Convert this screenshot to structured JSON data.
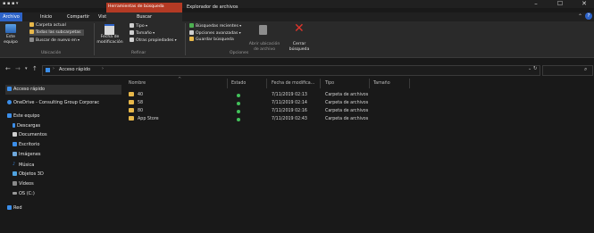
{
  "titlebar": {
    "quick_access": "▪ ▪ ▪ ▾",
    "minimize": "–",
    "maximize": "☐",
    "close": "✕"
  },
  "context_tabs": {
    "search_tools": "Herramientas de búsqueda",
    "window_title": "Explorador de archivos"
  },
  "tabs": [
    "Archivo",
    "Inicio",
    "Compartir",
    "Vista",
    "Buscar"
  ],
  "ribbon": {
    "ubicacion": {
      "este_equipo": "Este\nequipo",
      "carpeta_actual": "Carpeta actual",
      "todas_subcarpetas": "Todas las subcarpetas",
      "buscar_de_nuevo": "Buscar de nuevo en",
      "label": "Ubicación"
    },
    "refinar": {
      "fecha": "Fecha de\nmodificación",
      "tipo": "Tipo",
      "tamano": "Tamaño",
      "otras": "Otras propiedades",
      "label": "Refinar"
    },
    "opciones": {
      "recientes": "Búsquedas recientes",
      "avanzadas": "Opciones avanzadas",
      "guardar": "Guardar búsqueda",
      "abrir": "Abrir ubicación\nde archivo",
      "cerrar": "Cerrar\nbúsqueda",
      "label": "Opciones"
    }
  },
  "address": {
    "path": "Acceso rápido",
    "separator": "›",
    "search_placeholder": ""
  },
  "sidebar": [
    {
      "label": "Acceso rápido",
      "icon": "star-icon",
      "color": "#3b8eea"
    },
    {
      "label": "OneDrive - Consulting Group Corporac",
      "icon": "cloud-icon",
      "color": "#3b8eea"
    },
    {
      "label": "Este equipo",
      "icon": "computer-icon",
      "color": "#3b8eea"
    },
    {
      "label": "Descargas",
      "icon": "download-icon",
      "color": "#3b8eea"
    },
    {
      "label": "Documentos",
      "icon": "document-icon",
      "color": "#cfcfcf"
    },
    {
      "label": "Escritorio",
      "icon": "desktop-icon",
      "color": "#3b8eea"
    },
    {
      "label": "Imágenes",
      "icon": "image-icon",
      "color": "#6fa8dc"
    },
    {
      "label": "Música",
      "icon": "music-icon",
      "color": "#3b8eea"
    },
    {
      "label": "Objetos 3D",
      "icon": "cube-icon",
      "color": "#4fa3e0"
    },
    {
      "label": "Vídeos",
      "icon": "video-icon",
      "color": "#8a8a8a"
    },
    {
      "label": "OS (C:)",
      "icon": "drive-icon",
      "color": "#9a9a9a"
    },
    {
      "label": "Red",
      "icon": "network-icon",
      "color": "#3b8eea"
    }
  ],
  "columns": [
    "Nombre",
    "Estado",
    "Fecha de modifica...",
    "Tipo",
    "Tamaño"
  ],
  "rows": [
    {
      "name": "40",
      "date": "7/11/2019 02:13",
      "type": "Carpeta de archivos"
    },
    {
      "name": "58",
      "date": "7/11/2019 02:14",
      "type": "Carpeta de archivos"
    },
    {
      "name": "80",
      "date": "7/11/2019 02:16",
      "type": "Carpeta de archivos"
    },
    {
      "name": "App Store",
      "date": "7/11/2019 02:43",
      "type": "Carpeta de archivos"
    }
  ],
  "colors": {
    "accent": "#2d63c8",
    "context": "#b43a24",
    "status_ok": "#42c15a",
    "folder": "#e8b84a"
  }
}
